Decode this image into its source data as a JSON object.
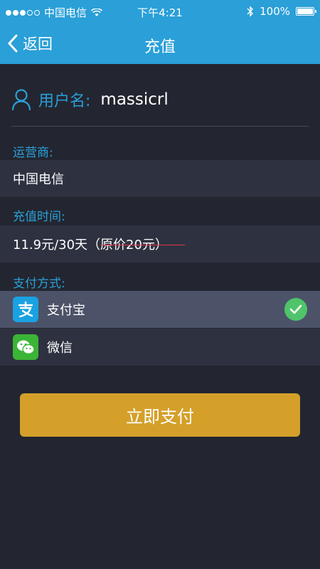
{
  "status_bar": {
    "carrier": "中国电信",
    "time": "下午4:21",
    "battery": "100%"
  },
  "nav": {
    "back_label": "返回",
    "title": "充值"
  },
  "user": {
    "label": "用户名:",
    "value": "massicrl"
  },
  "operator": {
    "label": "运营商:",
    "value": "中国电信"
  },
  "duration": {
    "label": "充值时间:",
    "value": "11.9元/30天",
    "original_price": "（原价20元）"
  },
  "payment": {
    "label": "支付方式:",
    "options": [
      {
        "name": "支付宝",
        "selected": true
      },
      {
        "name": "微信",
        "selected": false
      }
    ]
  },
  "action": {
    "pay_button": "立即支付"
  },
  "colors": {
    "accent": "#2a9fd8",
    "background": "#232630",
    "button": "#d4a02a",
    "check": "#4fc46a"
  }
}
